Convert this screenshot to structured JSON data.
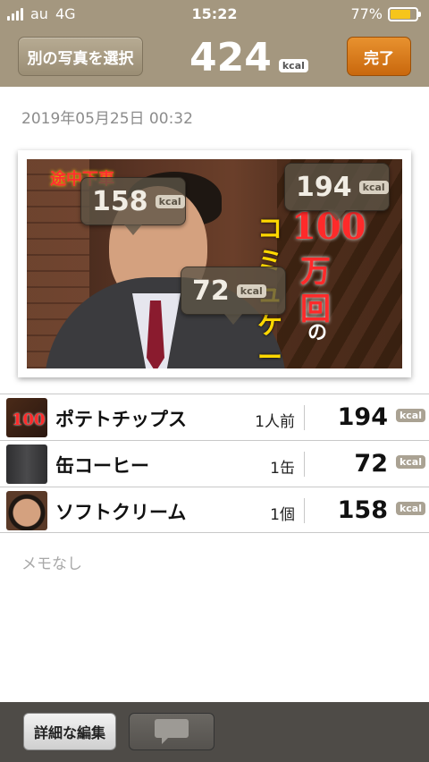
{
  "status_bar": {
    "carrier": "au",
    "network": "4G",
    "time": "15:22",
    "battery_pct": "77%",
    "battery_level": 0.77
  },
  "header": {
    "select_photo_label": "別の写真を選択",
    "total_kcal": "424",
    "unit": "kcal",
    "done_label": "完了"
  },
  "datetime": "2019年05月25日 00:32",
  "photo": {
    "logo_text": "途中下車",
    "overlay_text": {
      "hundred": "100",
      "man": "万",
      "kai": "回",
      "no": "の",
      "comi": "コミュケーション"
    },
    "tags": [
      {
        "value": "194",
        "unit": "kcal"
      },
      {
        "value": "158",
        "unit": "kcal"
      },
      {
        "value": "72",
        "unit": "kcal"
      }
    ]
  },
  "items": [
    {
      "name": "ポテトチップス",
      "portion": "1人前",
      "kcal": "194",
      "unit": "kcal",
      "thumb_text": "100"
    },
    {
      "name": "缶コーヒー",
      "portion": "1缶",
      "kcal": "72",
      "unit": "kcal"
    },
    {
      "name": "ソフトクリーム",
      "portion": "1個",
      "kcal": "158",
      "unit": "kcal"
    }
  ],
  "memo": "メモなし",
  "bottom_bar": {
    "edit_label": "詳細な編集",
    "comment_icon": "speech-bubble-icon"
  },
  "colors": {
    "header": "#a4977f",
    "done_button": "#d67a1c",
    "battery": "#f6c51b",
    "bottom_bar": "#4e4b47"
  }
}
